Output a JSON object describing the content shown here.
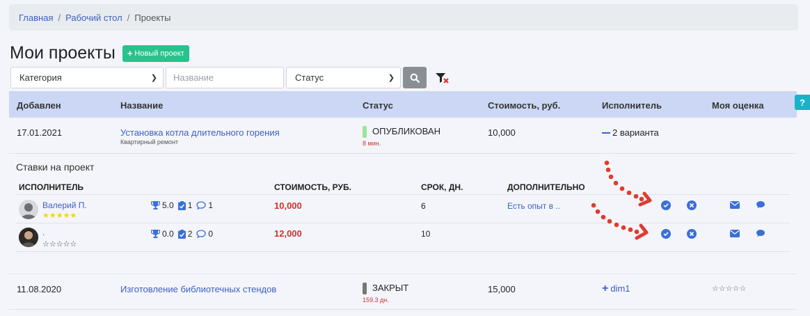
{
  "breadcrumb": {
    "home": "Главная",
    "desktop": "Рабочий стол",
    "current": "Проекты",
    "separator": "/"
  },
  "page": {
    "title": "Мои проекты",
    "new_project_label": "Новый проект"
  },
  "filters": {
    "category": "Категория",
    "name_placeholder": "Название",
    "status": "Статус"
  },
  "table": {
    "headers": {
      "added": "Добавлен",
      "name": "Название",
      "status": "Статус",
      "cost": "Стоимость, руб.",
      "executor": "Исполнитель",
      "rating": "Моя оценка"
    },
    "rows": [
      {
        "date": "17.01.2021",
        "name": "Установка котла длительного горения",
        "category": "Квартирный ремонт",
        "status": "ОПУБЛИКОВАН",
        "status_time": "8 мин.",
        "status_color": "#9be59b",
        "cost": "10,000",
        "executor": "2 варианта"
      },
      {
        "date": "11.08.2020",
        "name": "Изготовление библиотечных стендов",
        "status": "ЗАКРЫТ",
        "status_time": "159.3 дн.",
        "status_color": "#777777",
        "cost": "15,000",
        "executor": "dim1",
        "rating": "☆☆☆☆☆"
      }
    ]
  },
  "bids": {
    "title": "Ставки на проект",
    "headers": {
      "executor": "ИСПОЛНИТЕЛЬ",
      "cost": "СТОИМОСТЬ, РУБ.",
      "term": "СРОК, ДН.",
      "extra": "ДОПОЛНИТЕЛЬНО"
    },
    "rows": [
      {
        "name": "Валерий П.",
        "stars": "★★★★★",
        "trophy": "5.0",
        "tasks": "1",
        "comments": "1",
        "cost": "10,000",
        "term": "6",
        "extra": "Есть опыт в .."
      },
      {
        "name": ".",
        "stars": "☆☆☆☆☆",
        "trophy": "0.0",
        "tasks": "2",
        "comments": "0",
        "cost": "12,000",
        "term": "10",
        "extra": ""
      }
    ]
  },
  "help_label": "?",
  "colors": {
    "accent": "#3b5fc4",
    "success": "#28c38c",
    "danger": "#d0312d",
    "header_bg": "#cbd7f4",
    "arrow": "#e03b2e"
  }
}
